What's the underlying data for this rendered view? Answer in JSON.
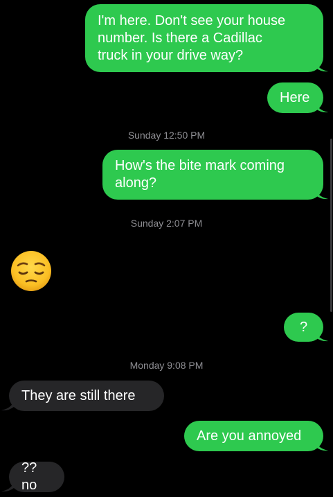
{
  "colors": {
    "sent_bubble": "#2ec94f",
    "received_bubble": "#262628",
    "background": "#000000",
    "timestamp_text": "#8e8e93"
  },
  "messages": {
    "m1": "I'm here. Don't see your house\nnumber. Is there a Cadillac\ntruck in your drive way?",
    "m2": "Here",
    "m3": "How's the bite mark coming\nalong?",
    "m4_emoji": "pensive-face-emoji",
    "m5": "?",
    "m6": "They are still there",
    "m7": "Are you annoyed",
    "m8": "??no"
  },
  "timestamps": {
    "t1": "Sunday 12:50 PM",
    "t2": "Sunday 2:07 PM",
    "t3": "Monday 9:08 PM"
  }
}
